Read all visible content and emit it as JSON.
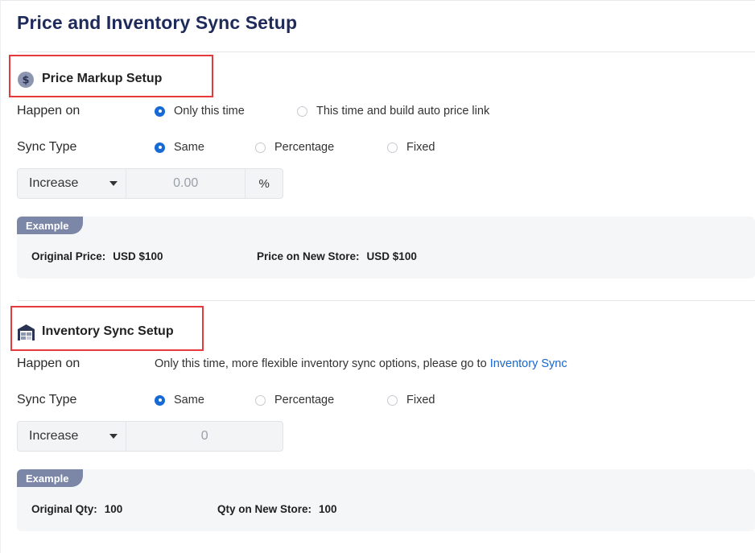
{
  "page_title": "Price and Inventory Sync Setup",
  "price": {
    "section_title": "Price Markup Setup",
    "happen_on": {
      "label": "Happen on",
      "options": [
        "Only this time",
        "This time and build auto price link"
      ],
      "selected": "Only this time"
    },
    "sync_type": {
      "label": "Sync Type",
      "options": [
        "Same",
        "Percentage",
        "Fixed"
      ],
      "selected": "Same"
    },
    "adjust": {
      "direction": "Increase",
      "value": "0.00",
      "unit": "%"
    },
    "example": {
      "tag": "Example",
      "original_label": "Original Price:",
      "original_value": "USD $100",
      "new_label": "Price on New Store:",
      "new_value": "USD $100"
    }
  },
  "inventory": {
    "section_title": "Inventory Sync Setup",
    "happen_on": {
      "label": "Happen on",
      "text": "Only this time, more flexible inventory sync options, please go to",
      "link": "Inventory Sync"
    },
    "sync_type": {
      "label": "Sync Type",
      "options": [
        "Same",
        "Percentage",
        "Fixed"
      ],
      "selected": "Same"
    },
    "adjust": {
      "direction": "Increase",
      "value": "0"
    },
    "example": {
      "tag": "Example",
      "original_label": "Original Qty:",
      "original_value": "100",
      "new_label": "Qty on New Store:",
      "new_value": "100"
    }
  },
  "colors": {
    "title": "#1e2a5a",
    "accent": "#1769d6",
    "highlight": "#e5393b",
    "example_tag": "#7c87a8"
  }
}
